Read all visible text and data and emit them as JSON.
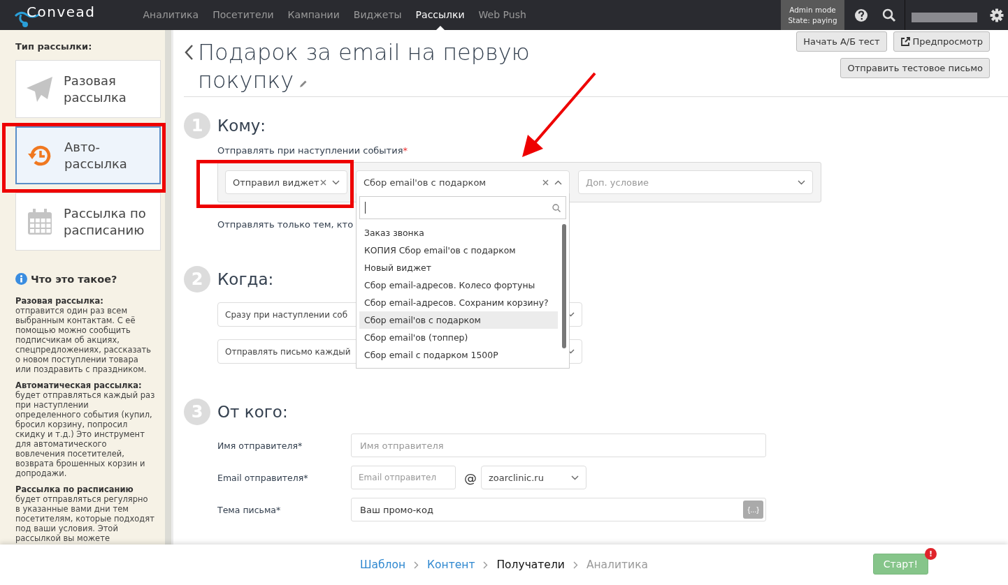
{
  "nav": {
    "logo": "Convead",
    "items": [
      {
        "label": "Аналитика",
        "selected": false
      },
      {
        "label": "Посетители",
        "selected": false
      },
      {
        "label": "Кампании",
        "selected": false
      },
      {
        "label": "Виджеты",
        "selected": false
      },
      {
        "label": "Рассылки",
        "selected": true
      },
      {
        "label": "Web Push",
        "selected": false
      }
    ],
    "admin_mode": [
      "Admin mode",
      "State: paying"
    ]
  },
  "sidebar": {
    "heading": "Тип рассылки:",
    "types": [
      {
        "kind": "one-time",
        "label": "Разовая рассылка",
        "selected": false
      },
      {
        "kind": "auto",
        "label": "Авто-рассылка",
        "selected": true
      },
      {
        "kind": "schedule",
        "label": "Рассылка по расписанию",
        "selected": false
      }
    ],
    "help": {
      "title": "Что это такое?",
      "sections": [
        {
          "title": "Разовая рассылка:",
          "body": "отправится один раз всем выбранным контактам. С её помощью можно сообщить подписчикам об акциях, спецпредложениях, рассказать о новом поступлении товара или поздравить с праздником."
        },
        {
          "title": "Автоматическая рассылка:",
          "body": "будет отправляться каждый раз при наступлении определенного события (купил, бросил корзину, попросил скидку и т.д.) Это инструмент для автоматического вовлечения посетителей, возврата брошенных корзин и допродажи."
        },
        {
          "title": "Рассылка по расписанию",
          "body": "будет отправляться регулярно в указанные вами дни тем посетителям, которые подходят под ваши условия. Этой рассылкой вы можете"
        }
      ]
    }
  },
  "page": {
    "title": "Подарок за email на первую покупку",
    "buttons": [
      {
        "kind": "plain",
        "label": "Начать А/Б тест"
      },
      {
        "kind": "preview",
        "label": "Предпросмотр"
      },
      {
        "kind": "plain",
        "label": "Отправить тестовое письмо"
      }
    ]
  },
  "step1": {
    "number": "1",
    "heading": "Кому:",
    "event_label": "Отправлять при наступлении события",
    "required_mark": "*",
    "filters": [
      {
        "value": "Отправил виджет",
        "open": false
      },
      {
        "value": "Сбор email'ов с подарком",
        "open": true
      },
      {
        "placeholder": "Доп. условие",
        "open": false
      }
    ],
    "dropdown": {
      "options": [
        {
          "label": "Заказ звонка",
          "selected": false
        },
        {
          "label": "КОПИЯ Сбор email'ов с подарком",
          "selected": false
        },
        {
          "label": "Новый виджет",
          "selected": false
        },
        {
          "label": "Сбор email-адресов. Колесо фортуны",
          "selected": false
        },
        {
          "label": "Сбор email-адресов. Сохраним корзину?",
          "selected": false
        },
        {
          "label": "Сбор email'ов с подарком",
          "selected": true
        },
        {
          "label": "Сбор email'ов (топпер)",
          "selected": false
        },
        {
          "label": "Сбор email с подарком 1500Р",
          "selected": false
        }
      ]
    },
    "only_to": "Отправлять только тем, кто"
  },
  "step2": {
    "number": "2",
    "heading": "Когда:",
    "selects": [
      "Сразу при наступлении соб",
      "Отправлять письмо каждый"
    ]
  },
  "step3": {
    "number": "3",
    "heading": "От кого:",
    "sender_name": {
      "label": "Имя отправителя*",
      "placeholder": "Имя отправителя"
    },
    "sender_email": {
      "label": "Email отправителя*",
      "placeholder": "Email отправител",
      "at": "@",
      "domain": "zoarclinic.ru"
    },
    "subject": {
      "label": "Тема письма*",
      "value": "Ваш промо-код",
      "vars_button": "{...}"
    }
  },
  "footer": {
    "steps": [
      {
        "label": "Шаблон",
        "completed": true,
        "selected": false
      },
      {
        "label": "Контент",
        "completed": true,
        "selected": false
      },
      {
        "label": "Получатели",
        "completed": false,
        "selected": true
      },
      {
        "label": "Аналитика",
        "completed": false,
        "selected": false
      }
    ],
    "start_button": "Старт!",
    "alert_badge": "!"
  }
}
